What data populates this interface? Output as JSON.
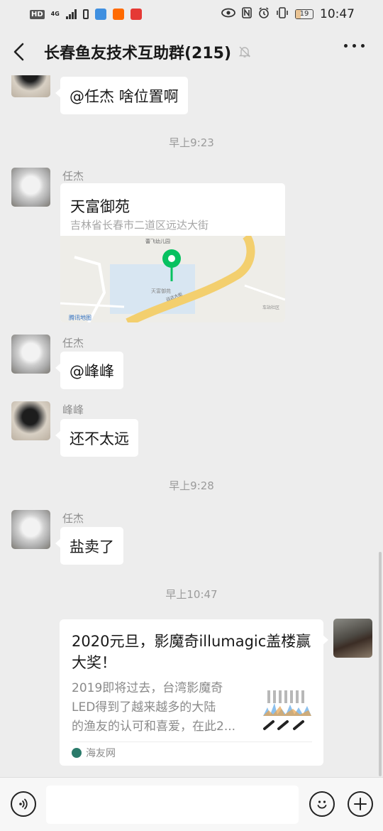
{
  "status_bar": {
    "left_badges": [
      "HD",
      "4G"
    ],
    "battery_level": "19",
    "time": "10:47"
  },
  "nav": {
    "title": "长春鱼友技术互助群(215)"
  },
  "chat": {
    "messages": [
      {
        "text": "@任杰  啥位置啊"
      },
      {
        "time": "早上9:23"
      },
      {
        "sender": "任杰",
        "location": {
          "title": "天富御苑",
          "address": "吉林省长春市二道区远达大街",
          "map_labels": [
            "蕾飞幼儿园",
            "天富御苑",
            "远达大街",
            "车站社区",
            "腾讯地图"
          ]
        }
      },
      {
        "sender": "任杰",
        "text": "@峰峰"
      },
      {
        "sender": "峰峰",
        "text": "还不太远"
      },
      {
        "time": "早上9:28"
      },
      {
        "sender": "任杰",
        "text": "盐卖了"
      },
      {
        "time": "早上10:47"
      },
      {
        "link_card": {
          "title": "2020元旦，影魔奇illumagic盖楼赢大奖！",
          "description_lines": [
            "2019即将过去，台湾影魔奇",
            "LED得到了越来越多的大陆",
            "的渔友的认可和喜爱，在此2..."
          ],
          "source": "海友网"
        }
      }
    ]
  },
  "colors": {
    "background": "#ededed",
    "bubble": "#ffffff",
    "map_pin": "#07c160",
    "road": "#f3cf6e"
  }
}
